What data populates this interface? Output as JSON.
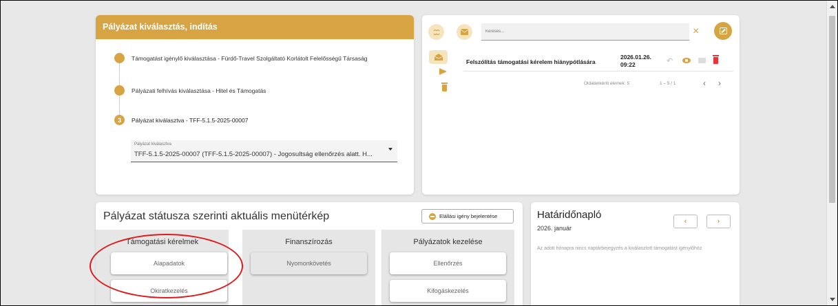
{
  "selection": {
    "header": "Pályázat kiválasztás, indítás",
    "steps": [
      {
        "marker": "",
        "text": "Támogatást igénylő kiválasztása - Fürdő-Travel Szolgáltató Korlátolt Felelősségű Társaság"
      },
      {
        "marker": "",
        "text": "Pályázati felhívás kiválasztása - Hitel és Támogatás"
      },
      {
        "marker": "3",
        "text": "Pályázat kiválasztva - TFF-5.1.5-2025-00007"
      }
    ],
    "select": {
      "label": "Pályázat kiválasztva",
      "value": "TFF-5.1.5-2025-00007 (TFF-5.1.5-2025-00007) - Jogosultság ellenőrzés alatt. H..."
    }
  },
  "messages": {
    "search_placeholder": "Keresés...",
    "close_symbol": "×",
    "items": [
      {
        "subject": "Felszólítás támogatási kérelem hiánypótlására",
        "date": "2026.01.26.",
        "time": "09:22"
      }
    ],
    "pager": {
      "per_page_label": "Oldalankénti elemek: 5",
      "range": "1 – 5 / 1",
      "prev": "‹",
      "next": "›"
    }
  },
  "menu_map": {
    "title": "Pályázat státusza szerinti aktuális menütérkép",
    "withdraw_button": "Elállási igény bejelentése",
    "columns": [
      {
        "title": "Támogatási kérelmek",
        "tiles": [
          "Alapadatok",
          "Okiratkezelés"
        ]
      },
      {
        "title": "Finanszírozás",
        "tiles": [
          "Nyomonkövetés"
        ]
      },
      {
        "title": "Pályázatok kezelése",
        "tiles": [
          "Ellenőrzés",
          "Kifogáskezelés"
        ]
      }
    ]
  },
  "deadline": {
    "title": "Határidőnapló",
    "month": "2026. január",
    "empty_text": "Az adott hónapra nincs naptárbejegyzés a kiválasztott támogatást igénylőhöz",
    "prev": "‹",
    "next": "›"
  },
  "colors": {
    "accent": "#d6a443",
    "accent_light": "#f6e4bf",
    "danger": "#e8333a",
    "highlight": "#e01a1a"
  }
}
